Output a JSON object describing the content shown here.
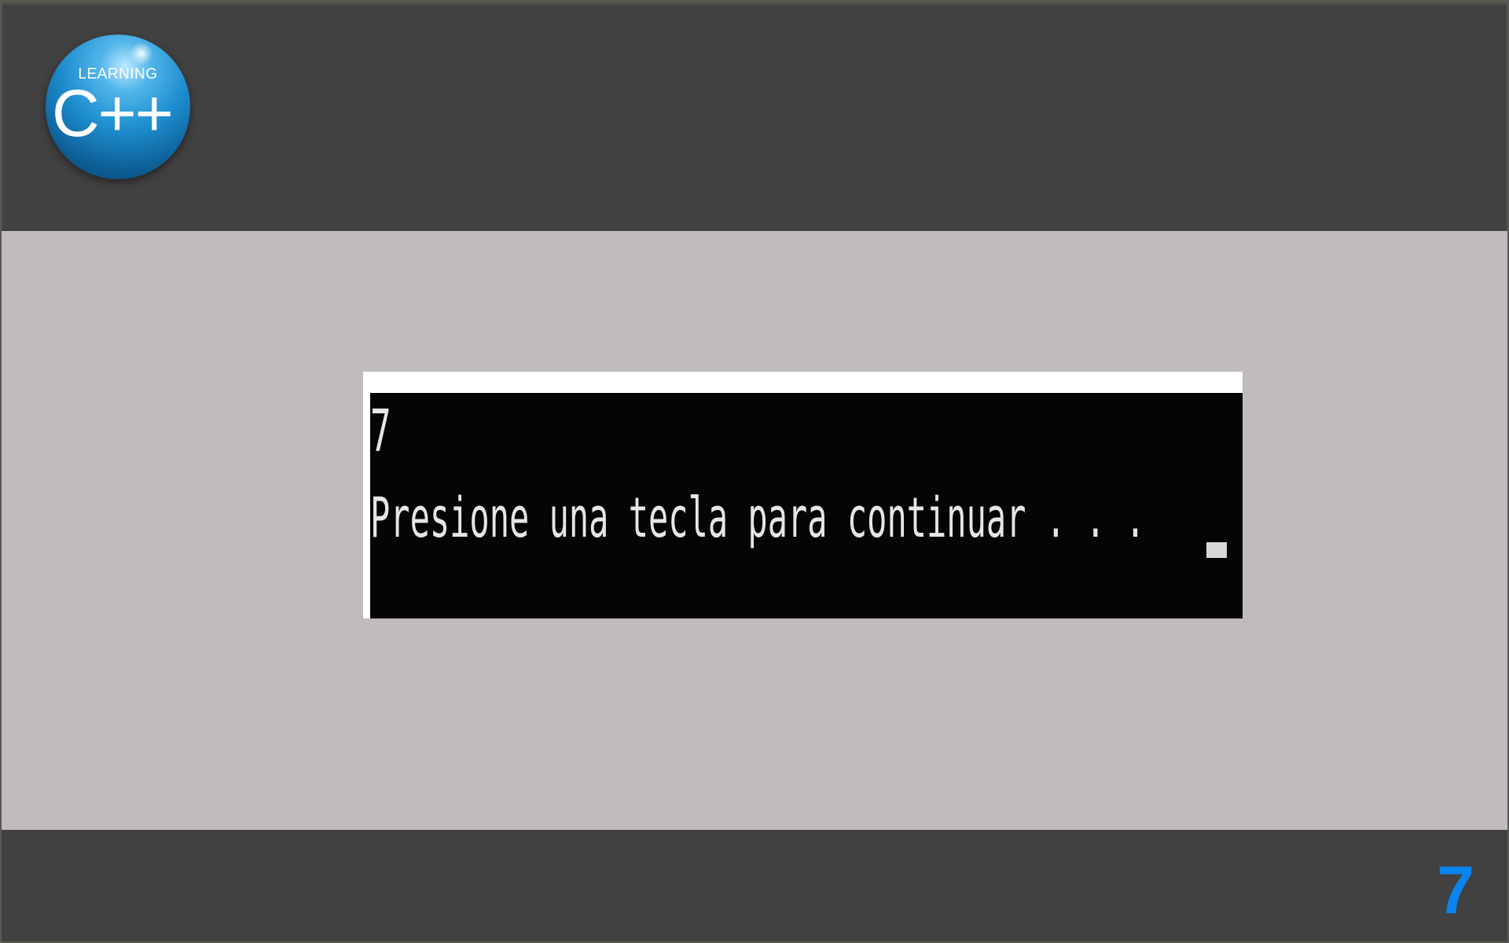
{
  "logo": {
    "top_text": "Learning",
    "main_text": "C++"
  },
  "console": {
    "lines": [
      "7",
      "Presione una tecla para continuar . . ."
    ]
  },
  "slide": {
    "page_number": "7"
  },
  "colors": {
    "header_band": "#414141",
    "content_background": "#c0bbbf",
    "console_background": "#050505",
    "page_number": "#0a84f0"
  }
}
